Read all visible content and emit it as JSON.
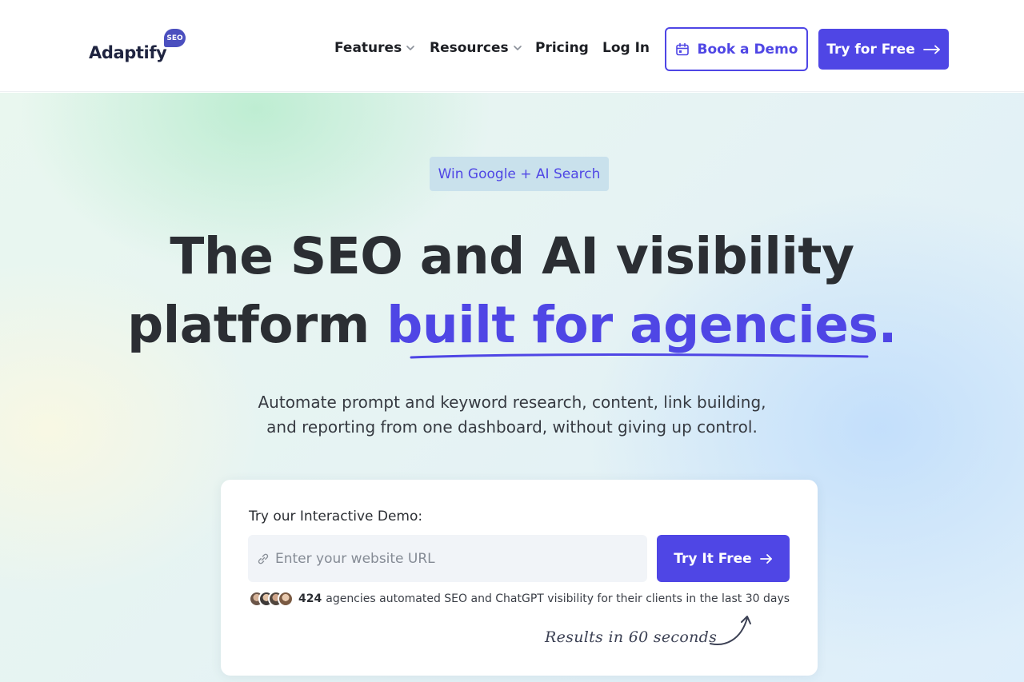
{
  "brand": {
    "name": "Adaptify",
    "badge": "SEO",
    "accent_color": "#4f46e5"
  },
  "nav": {
    "items": [
      {
        "label": "Features",
        "icon": "chevron-down-icon"
      },
      {
        "label": "Resources",
        "icon": "chevron-down-icon"
      },
      {
        "label": "Pricing"
      },
      {
        "label": "Log In"
      }
    ],
    "book_demo": {
      "label": "Book a Demo",
      "icon": "calendar-icon"
    },
    "try_free": {
      "label": "Try for Free",
      "icon": "arrow-right-icon"
    }
  },
  "hero": {
    "badge": "Win Google + AI Search",
    "headline_line1": "The SEO and AI visibility",
    "headline_line2_plain": "platform ",
    "headline_line2_accent": "built for agencies.",
    "subhead_line1": "Automate prompt and keyword research, content, link building,",
    "subhead_line2": "and reporting from one dashboard, without giving up control."
  },
  "demo": {
    "title": "Try our Interactive Demo:",
    "input_placeholder": "Enter your website URL",
    "input_value": "",
    "input_icon": "link-icon",
    "button_label": "Try It Free",
    "button_icon": "arrow-right-icon",
    "social_count": "424",
    "social_text": "agencies automated SEO and ChatGPT visibility for their clients in the last 30 days",
    "results_note": "Results in 60 seconds"
  }
}
